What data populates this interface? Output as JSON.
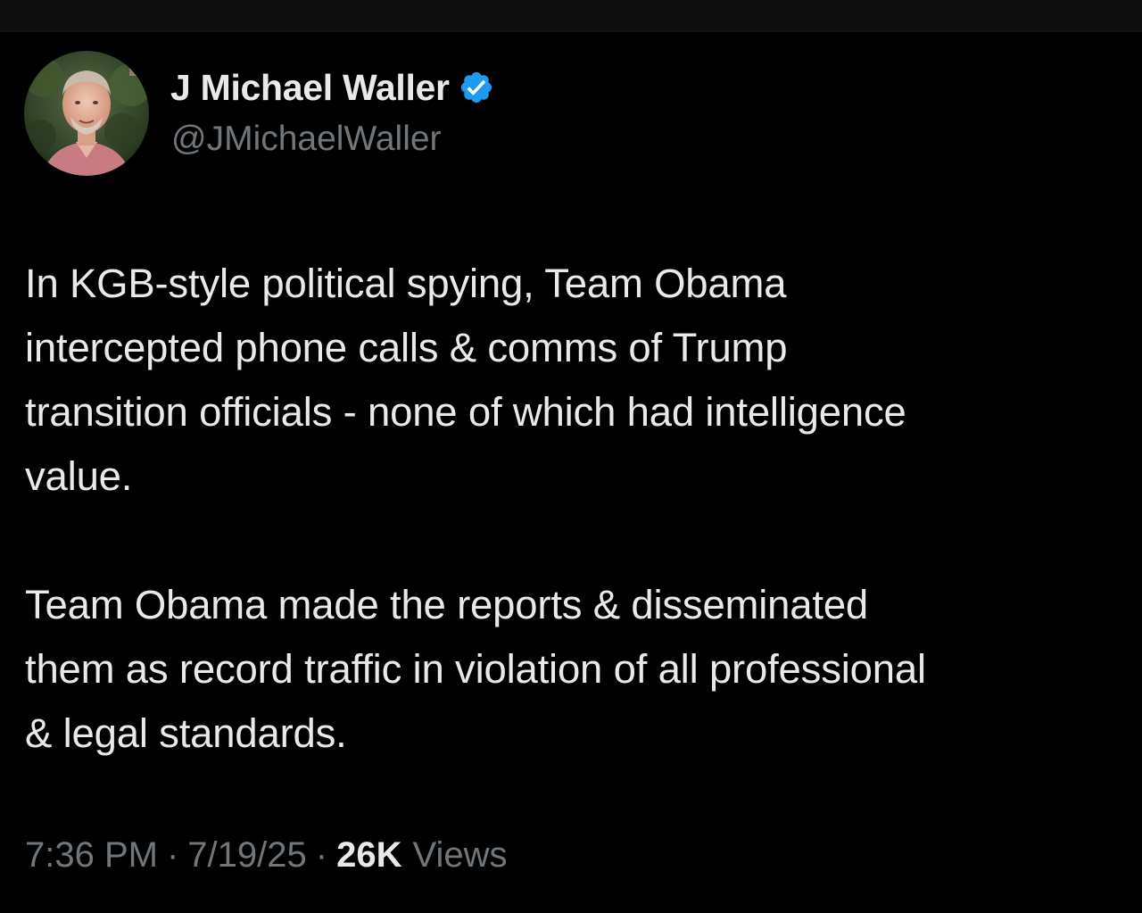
{
  "tweet": {
    "author": {
      "display_name": "J Michael Waller",
      "handle": "@JMichaelWaller",
      "verified": true,
      "verified_color": "#1d9bf0"
    },
    "paragraphs": [
      "In KGB-style political spying, Team Obama\nintercepted phone calls & comms of Trump\ntransition officials - none of which had intelligence\nvalue.",
      "Team Obama made the reports & disseminated\nthem as record traffic in violation of all professional\n& legal standards."
    ],
    "meta": {
      "time": "7:36 PM",
      "separator": "·",
      "date": "7/19/25",
      "views_count": "26K",
      "views_label": "Views"
    }
  },
  "colors": {
    "background": "#000000",
    "primary_text": "#e7e9ea",
    "secondary_text": "#71767b",
    "top_bar": "#0f0f0f"
  },
  "icons": {
    "verified": "verified-badge-icon",
    "avatar": "profile-photo"
  }
}
